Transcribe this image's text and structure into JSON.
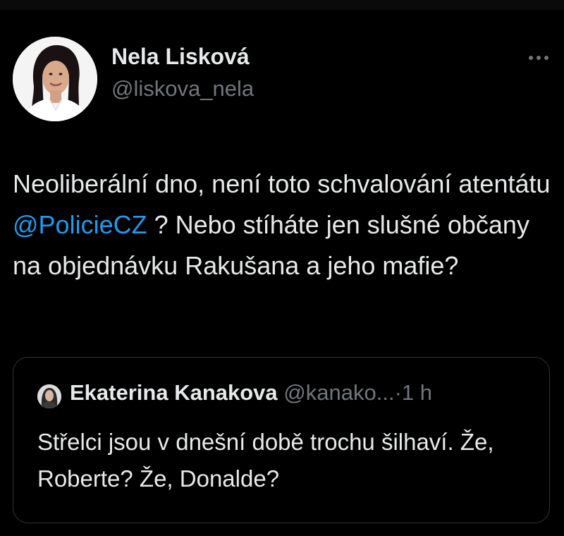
{
  "tweet": {
    "author": {
      "name": "Nela Lisková",
      "handle": "@liskova_nela"
    },
    "more_icon": "more-horizontal-icon",
    "text_before": "Neoliberální dno, není toto schvalování atentátu ",
    "mention": "@PolicieCZ",
    "text_after": " ? Nebo stíháte jen slušné občany na objednávku Rakušana a jeho mafie?",
    "quote": {
      "name": "Ekaterina Kanakova",
      "handle": "@kanako...",
      "separator": "·",
      "time": "1 h",
      "text": "Střelci jsou v dnešní době trochu šilhaví. Že, Roberte? Že, Donalde?"
    }
  },
  "colors": {
    "background": "#000000",
    "text": "#e7e9ea",
    "secondary": "#71767b",
    "link": "#1d9bf0",
    "border": "#2f3336"
  }
}
